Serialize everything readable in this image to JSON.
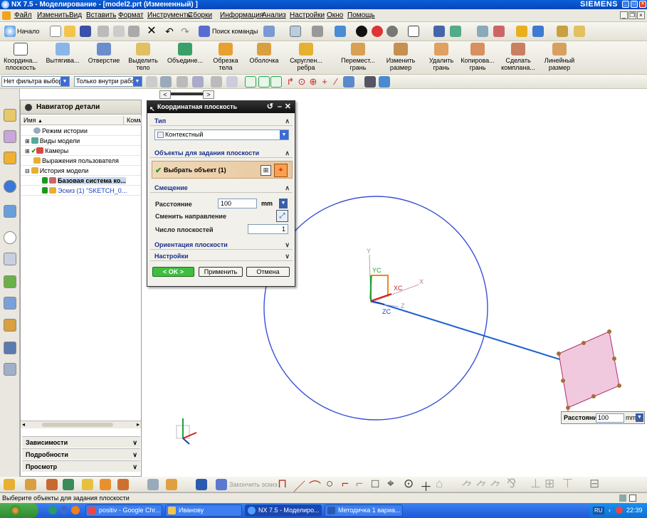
{
  "window": {
    "title": "NX 7.5 - Моделирование - [model2.prt (Измененный) ]",
    "brand": "SIEMENS"
  },
  "menu": [
    "Файл",
    "Изменить",
    "Вид",
    "Вставить",
    "Формат",
    "Инструменты",
    "Сборки",
    "Информация",
    "Анализ",
    "Настройки",
    "Окно",
    "Помощь"
  ],
  "toolbar1": {
    "start_label": "Начало",
    "find_command": "Поиск команды"
  },
  "toolbar2": [
    {
      "label": "Координа... плоскость"
    },
    {
      "label": "Вытягива..."
    },
    {
      "label": "Отверстие"
    },
    {
      "label": "Выделить тело"
    },
    {
      "label": "Объедине..."
    },
    {
      "label": "Обрезка тела"
    },
    {
      "label": "Оболочка"
    },
    {
      "label": "Скруглен... ребра"
    },
    {
      "label": "Перемест... грань"
    },
    {
      "label": "Изменить размер"
    },
    {
      "label": "Удалить грань"
    },
    {
      "label": "Копирова... грань"
    },
    {
      "label": "Сделать комплана..."
    },
    {
      "label": "Линейный размер"
    }
  ],
  "selection_bar": {
    "filter": "Нет фильтра выбор",
    "scope": "Только внутри рабо"
  },
  "navigator": {
    "title": "Навигатор детали",
    "col_name": "Имя",
    "col_comment": "Комм",
    "items": [
      {
        "label": "Режим истории",
        "indent": 0
      },
      {
        "label": "Виды модели",
        "indent": 0
      },
      {
        "label": "Камеры",
        "indent": 0
      },
      {
        "label": "Выражения пользователя",
        "indent": 0
      },
      {
        "label": "История модели",
        "indent": 0
      },
      {
        "label": "Базовая система ко...",
        "indent": 1,
        "selected": true
      },
      {
        "label": "Эскиз (1) \"SKETCH_0...",
        "indent": 1
      }
    ],
    "sections": [
      "Зависимости",
      "Подробности",
      "Просмотр"
    ]
  },
  "dialog": {
    "title": "Координатная плоскость",
    "sec_type": "Тип",
    "type_value": "Контекстный",
    "sec_objects": "Объекты для задания плоскости",
    "select_object": "Выбрать объект (1)",
    "sec_offset": "Смещение",
    "distance_label": "Расстояние",
    "distance_value": "100",
    "unit": "mm",
    "flip_label": "Сменить направление",
    "count_label": "Число плоскостей",
    "count_value": "1",
    "sec_orient": "Ориентация плоскости",
    "sec_settings": "Настройки",
    "ok": "< OK >",
    "apply": "Применить",
    "cancel": "Отмена"
  },
  "graphics": {
    "axis_labels": {
      "y": "Y",
      "yc": "YC",
      "xc": "XC",
      "x": "X",
      "zc": "ZC",
      "z": "Z"
    },
    "onscreen_input": {
      "label": "Расстояние",
      "value": "100",
      "unit": "mm"
    },
    "colors": {
      "circle": "#3a4fd8",
      "plane": "#e7b9d4",
      "plane_edge": "#b0306a",
      "vector": "#1f5fd0"
    }
  },
  "bottom_toolbar": {
    "finish_sketch": "Закончить эскиз"
  },
  "status": "Выберите объекты для задания плоскости",
  "taskbar": {
    "items": [
      "positiv - Google Chr...",
      "Иванову",
      "NX 7.5 - Моделиро...",
      "Методичка 1 вариа..."
    ],
    "lang": "RU",
    "time": "22:39"
  }
}
